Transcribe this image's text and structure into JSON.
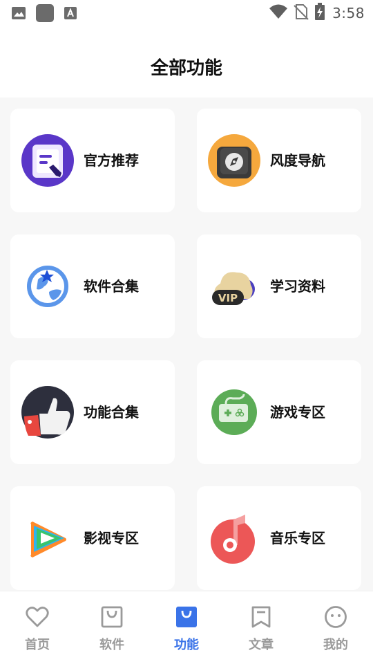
{
  "status_bar": {
    "time": "3:58",
    "left_icons": [
      "gallery-icon",
      "app-square-icon",
      "font-a-icon"
    ],
    "right_icons": [
      "wifi-icon",
      "no-sim-icon",
      "battery-charging-icon"
    ]
  },
  "header": {
    "title": "全部功能"
  },
  "features": [
    {
      "label": "官方推荐",
      "icon": "official-recommend-icon"
    },
    {
      "label": "风度导航",
      "icon": "compass-navigation-icon"
    },
    {
      "label": "软件合集",
      "icon": "globe-star-icon"
    },
    {
      "label": "学习资料",
      "icon": "vip-cloud-icon"
    },
    {
      "label": "功能合集",
      "icon": "thumbs-up-icon"
    },
    {
      "label": "游戏专区",
      "icon": "game-controller-icon"
    },
    {
      "label": "影视专区",
      "icon": "video-play-icon"
    },
    {
      "label": "音乐专区",
      "icon": "music-note-icon"
    }
  ],
  "bottom_nav": {
    "active_index": 2,
    "active_color": "#3a73e8",
    "inactive_color": "#9a9a9a",
    "items": [
      {
        "label": "首页",
        "icon": "heart-icon"
      },
      {
        "label": "软件",
        "icon": "shopping-bag-icon"
      },
      {
        "label": "功能",
        "icon": "shopping-bag-icon"
      },
      {
        "label": "文章",
        "icon": "bookmark-icon"
      },
      {
        "label": "我的",
        "icon": "smiley-face-icon"
      }
    ]
  }
}
